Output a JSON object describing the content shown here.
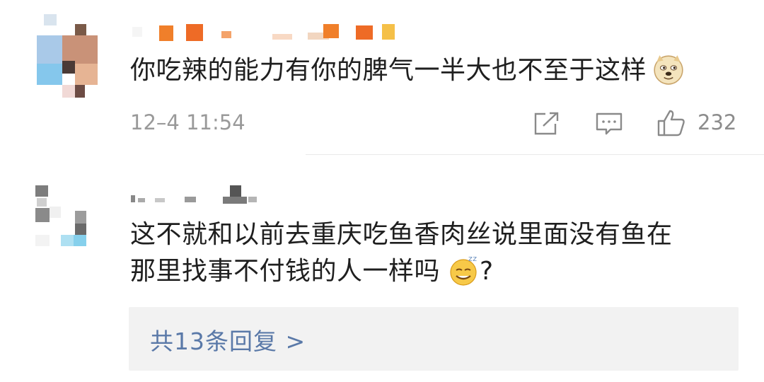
{
  "comments": [
    {
      "text": "你吃辣的能力有你的脾气一半大也不至于这样",
      "emoji": "doge-emoji",
      "time": "12–4 11:54",
      "likes": "232",
      "actions": [
        "share-icon",
        "comment-icon",
        "like-icon"
      ]
    },
    {
      "text_line1": "这不就和以前去重庆吃鱼香肉丝说里面没有鱼在",
      "text_line2": "那里找事不付钱的人一样吗",
      "emoji": "thinking-smile-emoji",
      "text_suffix": "?",
      "reply_link": "共13条回复 >"
    }
  ],
  "colors": {
    "reply_link": "#5a79a8",
    "meta": "#999999",
    "reply_bg": "#f2f2f2"
  }
}
